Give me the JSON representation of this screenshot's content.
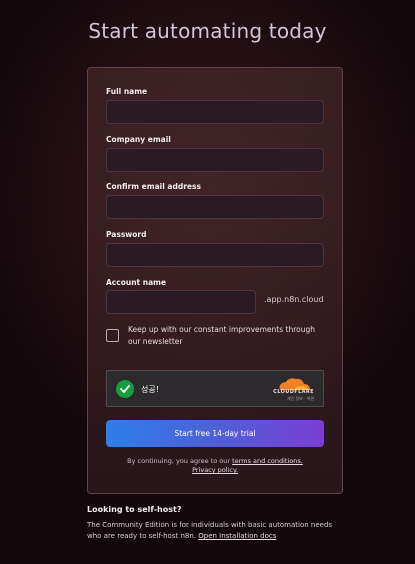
{
  "page": {
    "title": "Start automating today"
  },
  "form": {
    "full_name": {
      "label": "Full name",
      "value": "",
      "placeholder": ""
    },
    "company_email": {
      "label": "Company email",
      "value": "",
      "placeholder": ""
    },
    "confirm_email": {
      "label": "Confirm email address",
      "value": "",
      "placeholder": ""
    },
    "password": {
      "label": "Password",
      "value": "",
      "placeholder": ""
    },
    "account_name": {
      "label": "Account name",
      "value": "",
      "placeholder": "",
      "suffix": ".app.n8n.cloud"
    },
    "newsletter": {
      "label": "Keep up with our constant improvements through our newsletter",
      "checked": false
    },
    "captcha": {
      "status": "성공!",
      "brand": "CLOUDFLARE",
      "links": "개인 정보 · 약관"
    },
    "submit_label": "Start free 14-day trial",
    "terms": {
      "prefix": "By continuing, you agree to our",
      "terms_link": "terms and conditions.",
      "privacy_link": "Privacy policy."
    }
  },
  "self_host": {
    "title": "Looking to self-host?",
    "text": "The Community Edition is for individuals with basic automation needs who are ready to self-host n8n.",
    "link": "Open Installation docs"
  },
  "colors": {
    "accent_start": "#2f7fe6",
    "accent_end": "#7a3fd0",
    "success": "#1a9b3e",
    "cloudflare_orange": "#f38020"
  }
}
